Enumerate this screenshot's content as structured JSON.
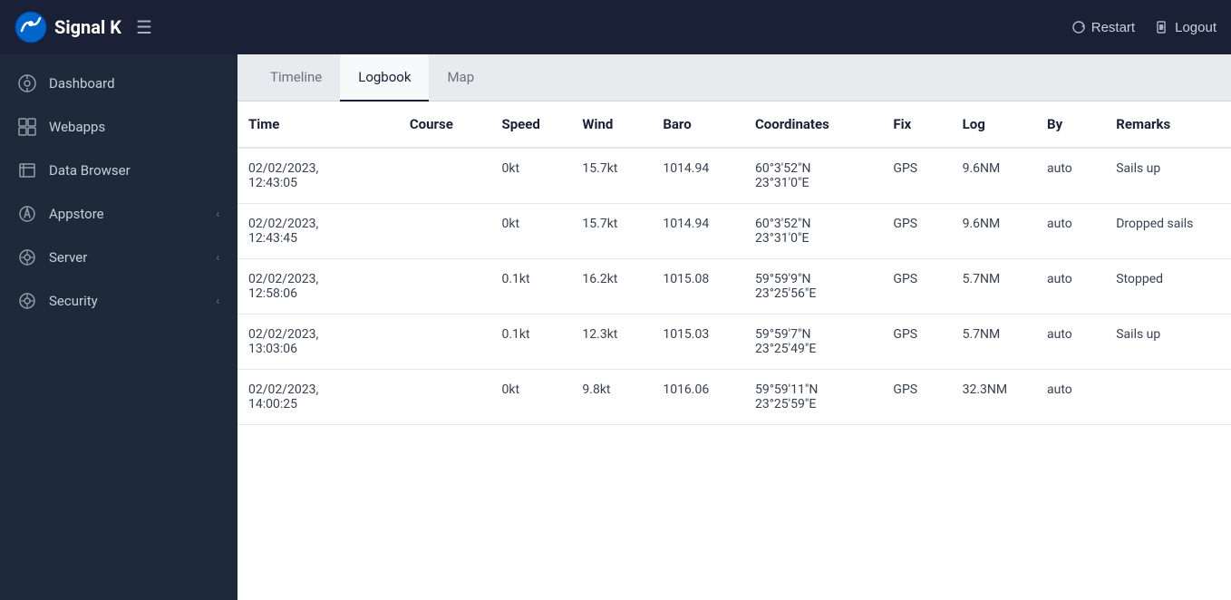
{
  "app": {
    "name": "Signal K",
    "restart_label": "Restart",
    "logout_label": "Logout"
  },
  "sidebar": {
    "items": [
      {
        "id": "dashboard",
        "label": "Dashboard",
        "icon": "dashboard-icon",
        "arrow": false
      },
      {
        "id": "webapps",
        "label": "Webapps",
        "icon": "webapps-icon",
        "arrow": false
      },
      {
        "id": "data-browser",
        "label": "Data Browser",
        "icon": "data-browser-icon",
        "arrow": false
      },
      {
        "id": "appstore",
        "label": "Appstore",
        "icon": "appstore-icon",
        "arrow": true
      },
      {
        "id": "server",
        "label": "Server",
        "icon": "server-icon",
        "arrow": true
      },
      {
        "id": "security",
        "label": "Security",
        "icon": "security-icon",
        "arrow": true
      }
    ]
  },
  "tabs": [
    {
      "id": "timeline",
      "label": "Timeline"
    },
    {
      "id": "logbook",
      "label": "Logbook",
      "active": true
    },
    {
      "id": "map",
      "label": "Map"
    }
  ],
  "table": {
    "headers": [
      "Time",
      "Course",
      "Speed",
      "Wind",
      "Baro",
      "Coordinates",
      "Fix",
      "Log",
      "By",
      "Remarks"
    ],
    "rows": [
      {
        "time": "02/02/2023,\n12:43:05",
        "course": "",
        "speed": "0kt",
        "wind": "15.7kt",
        "baro": "1014.94",
        "coordinates": "60°3′52″N\n23°31′0″E",
        "fix": "GPS",
        "log": "9.6NM",
        "by": "auto",
        "remarks": "Sails up"
      },
      {
        "time": "02/02/2023,\n12:43:45",
        "course": "",
        "speed": "0kt",
        "wind": "15.7kt",
        "baro": "1014.94",
        "coordinates": "60°3′52″N\n23°31′0″E",
        "fix": "GPS",
        "log": "9.6NM",
        "by": "auto",
        "remarks": "Dropped sails"
      },
      {
        "time": "02/02/2023,\n12:58:06",
        "course": "",
        "speed": "0.1kt",
        "wind": "16.2kt",
        "baro": "1015.08",
        "coordinates": "59°59′9″N\n23°25′56″E",
        "fix": "GPS",
        "log": "5.7NM",
        "by": "auto",
        "remarks": "Stopped"
      },
      {
        "time": "02/02/2023,\n13:03:06",
        "course": "",
        "speed": "0.1kt",
        "wind": "12.3kt",
        "baro": "1015.03",
        "coordinates": "59°59′7″N\n23°25′49″E",
        "fix": "GPS",
        "log": "5.7NM",
        "by": "auto",
        "remarks": "Sails up"
      },
      {
        "time": "02/02/2023,\n14:00:25",
        "course": "",
        "speed": "0kt",
        "wind": "9.8kt",
        "baro": "1016.06",
        "coordinates": "59°59′11″N\n23°25′59″E",
        "fix": "GPS",
        "log": "32.3NM",
        "by": "auto",
        "remarks": ""
      }
    ]
  }
}
